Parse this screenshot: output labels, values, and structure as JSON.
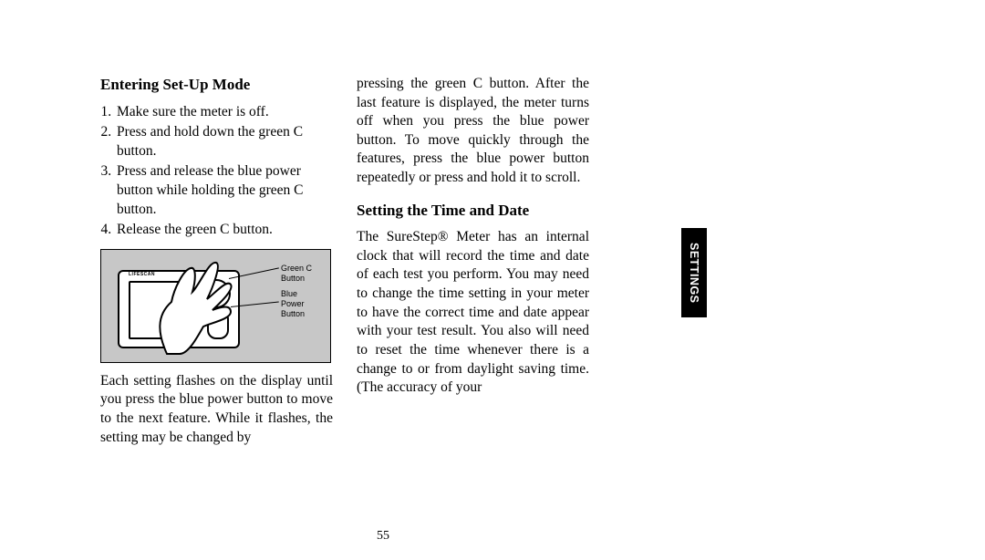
{
  "left": {
    "heading": "Entering Set-Up Mode",
    "steps": [
      "Make sure the meter is off.",
      "Press and hold down the green C button.",
      "Press and release the blue power button while holding the green C button.",
      "Release the green C button."
    ],
    "figure_labels": {
      "green_c": "Green C Button",
      "blue_power_l1": "Blue",
      "blue_power_l2": "Power",
      "blue_power_l3": "Button",
      "brand": "LIFESCAN"
    },
    "after_figure": "Each setting flashes on the display until you press the blue power button to move to the next feature. While it flashes, the setting may be changed by"
  },
  "right": {
    "continuation": "pressing the green C button. After the last feature is displayed, the meter turns off when you press the blue power button. To move quickly through the features, press the blue power button repeatedly or press and hold it to scroll.",
    "heading": "Setting the Time and Date",
    "para": "The SureStep® Meter has an internal clock that will record the time and date of each test you perform. You may need to change the time setting in your meter to have the correct time and date appear with your test result. You also will need to reset the time whenever there is a change to or from daylight saving time. (The accuracy of your"
  },
  "side_tab": "SETTINGS",
  "page_number": "55"
}
